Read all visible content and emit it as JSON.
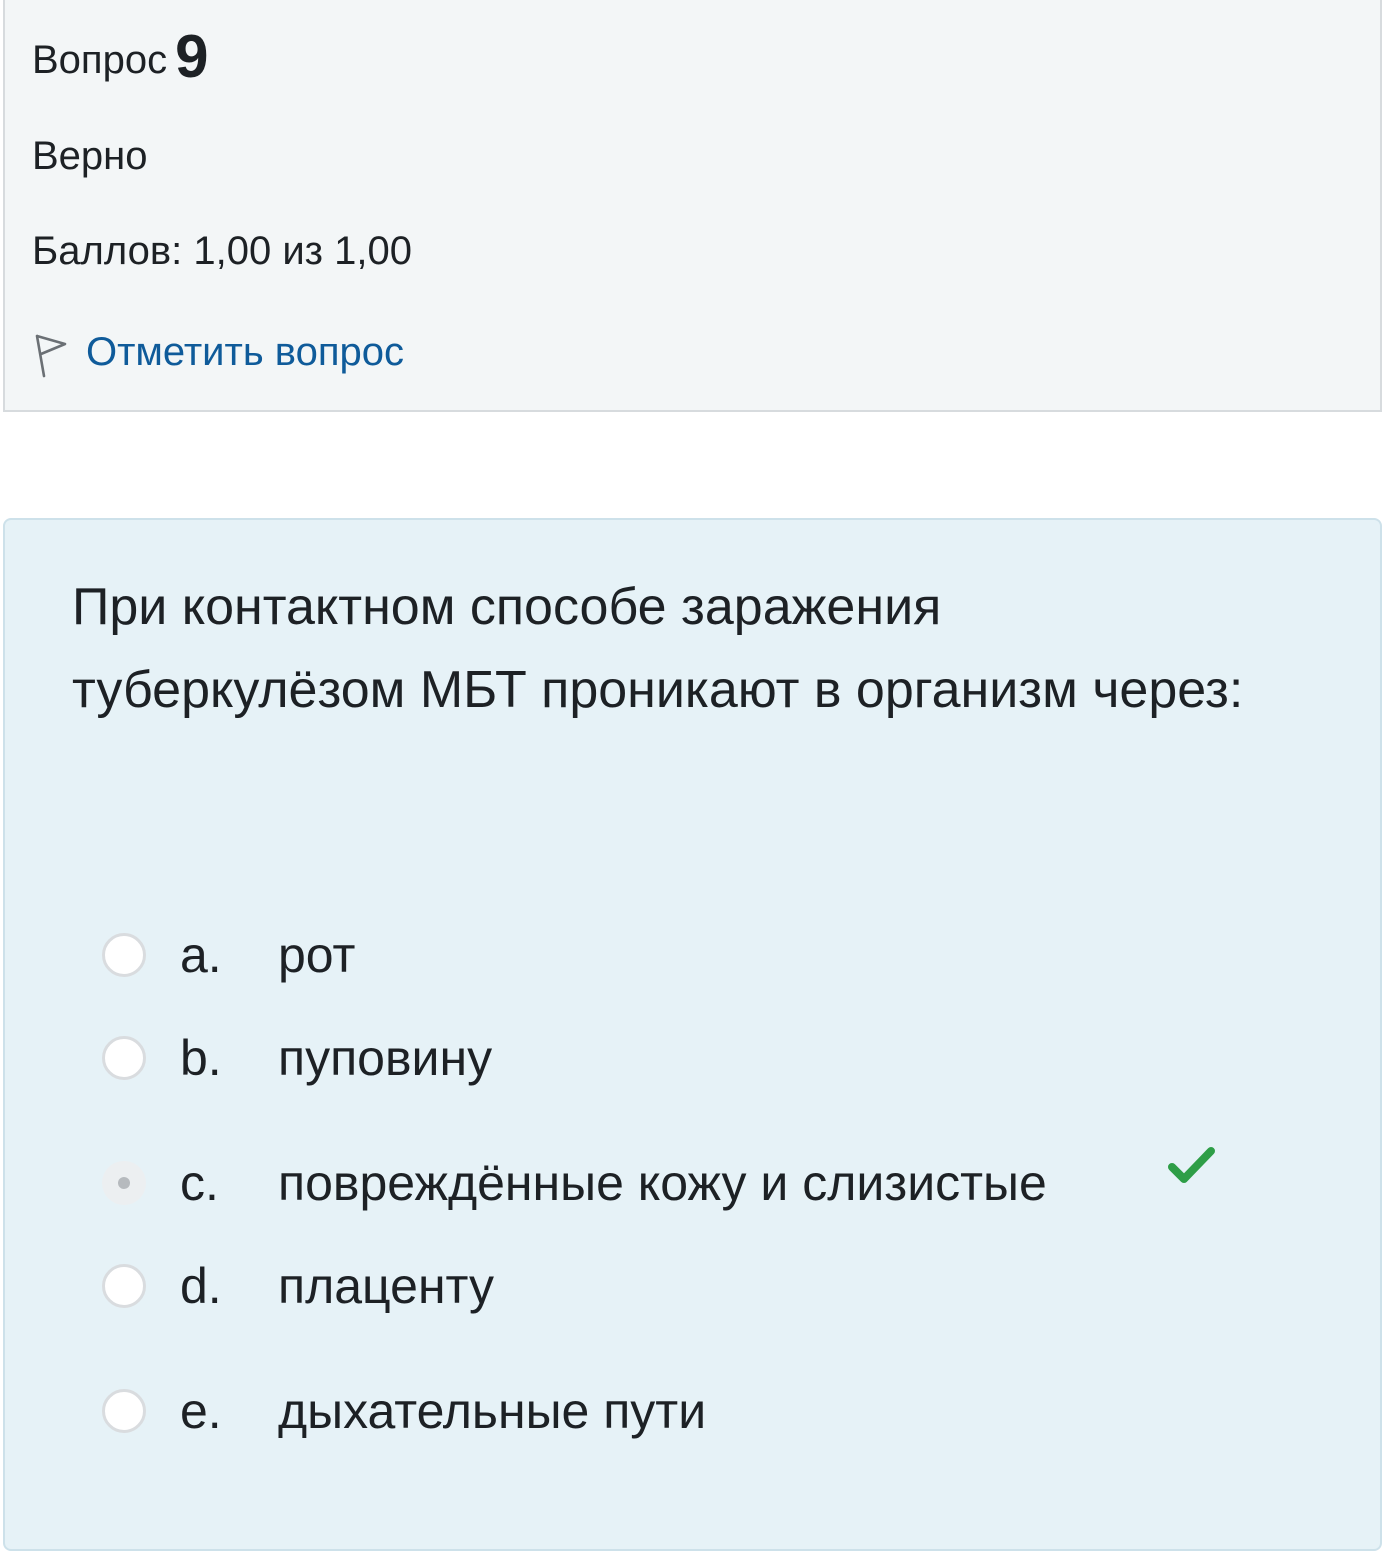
{
  "info": {
    "question_label": "Вопрос",
    "question_number": "9",
    "state": "Верно",
    "grade": "Баллов: 1,00 из 1,00",
    "flag_label": "Отметить вопрос"
  },
  "question": {
    "text": "При контактном способе заражения туберкулёзом МБТ проникают в организм через:",
    "answers": [
      {
        "letter": "a.",
        "text": "рот",
        "selected": false
      },
      {
        "letter": "b.",
        "text": "пуповину",
        "selected": false
      },
      {
        "letter": "c.",
        "text": "повреждённые кожу и слизистые",
        "selected": true,
        "correct_mark": "check-icon"
      },
      {
        "letter": "d.",
        "text": "плаценту",
        "selected": false
      },
      {
        "letter": "e.",
        "text": "дыхательные пути",
        "selected": false
      }
    ]
  },
  "colors": {
    "info_background": "#f3f6f7",
    "question_background": "#e6f2f7",
    "link": "#0f5b9a",
    "correct": "#2e9e47"
  }
}
